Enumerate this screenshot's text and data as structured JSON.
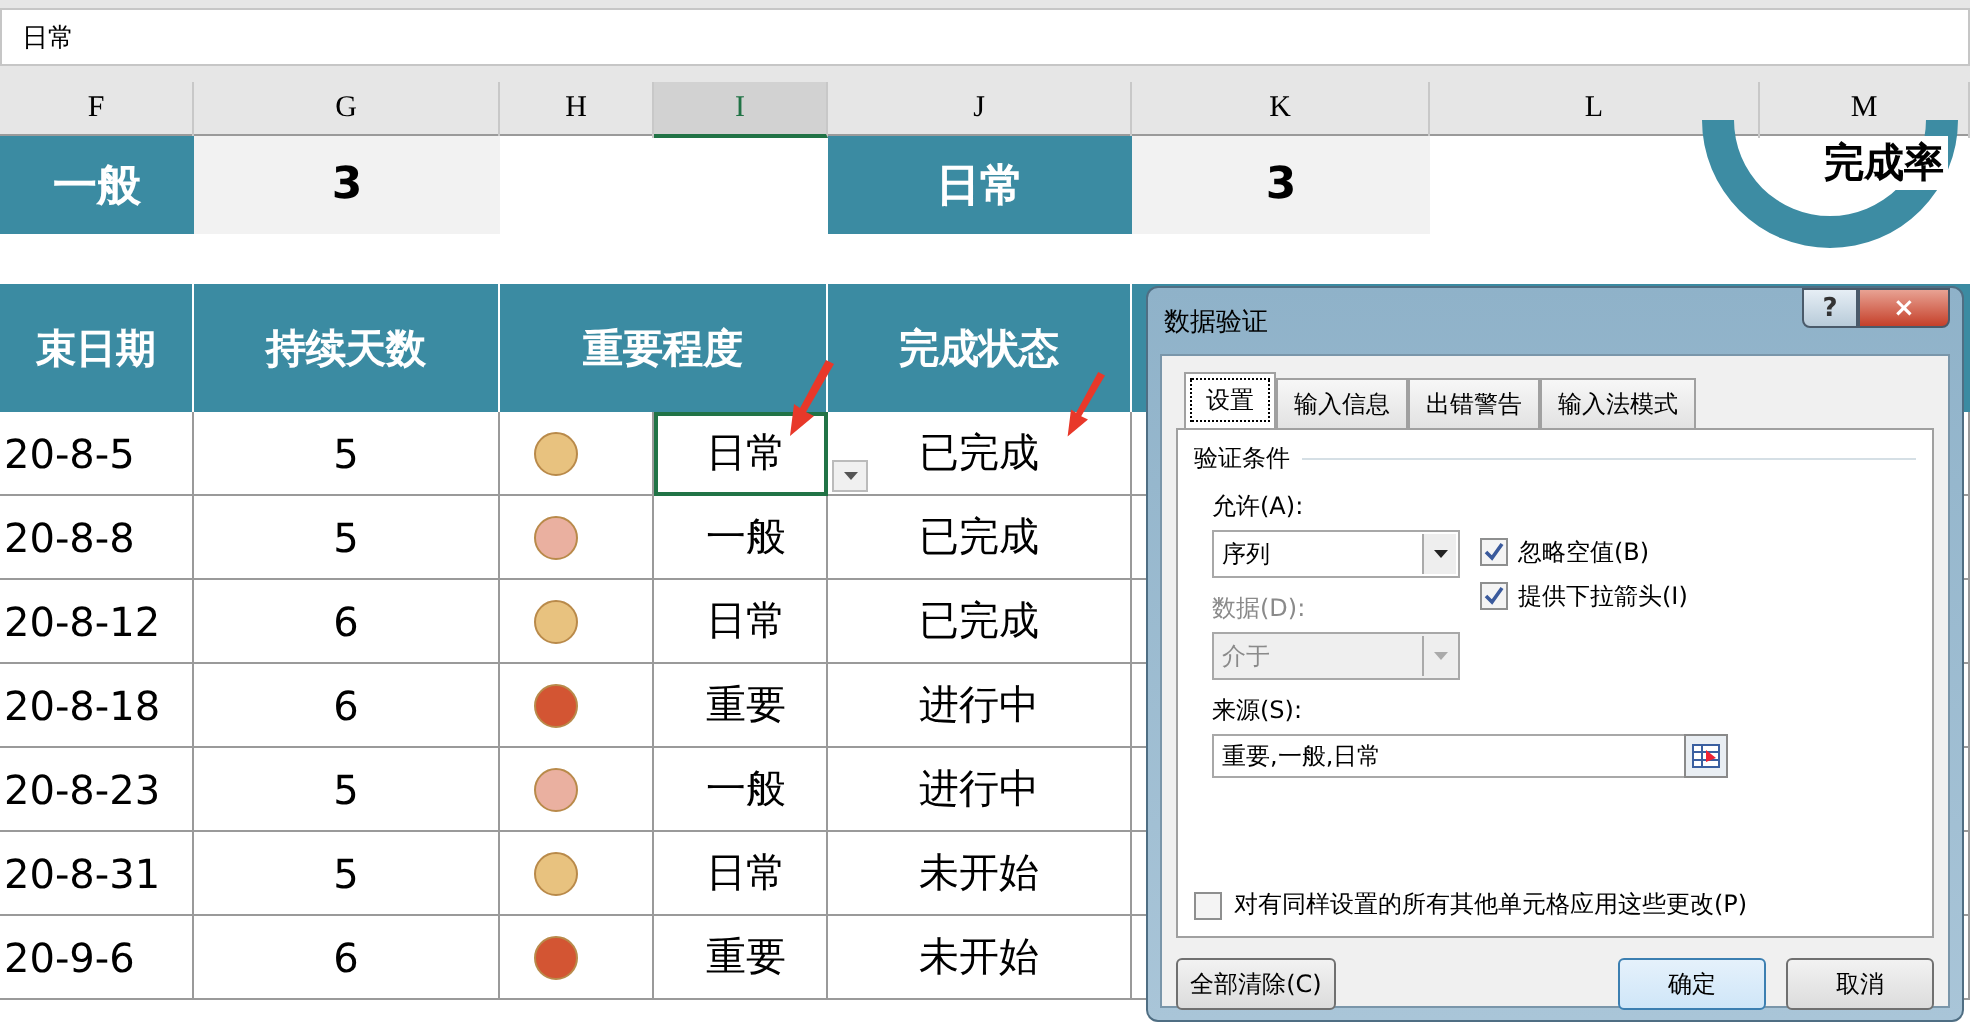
{
  "formula_bar": {
    "value": "日常"
  },
  "column_headers": [
    {
      "label": "F",
      "selected": false
    },
    {
      "label": "G",
      "selected": false
    },
    {
      "label": "H",
      "selected": false
    },
    {
      "label": "I",
      "selected": true
    },
    {
      "label": "J",
      "selected": false
    },
    {
      "label": "K",
      "selected": false
    },
    {
      "label": "L",
      "selected": false
    },
    {
      "label": "M",
      "selected": false
    }
  ],
  "summary": [
    {
      "kind": "label",
      "text": "一般"
    },
    {
      "kind": "value",
      "text": "3"
    },
    {
      "kind": "empty"
    },
    {
      "kind": "label",
      "text": "日常"
    },
    {
      "kind": "value",
      "text": "3"
    }
  ],
  "donut_chart": {
    "label": "完成率"
  },
  "table": {
    "columns": [
      "束日期",
      "持续天数",
      "重要程度",
      "完成状态"
    ],
    "rows": [
      {
        "end_date": "20-8-5",
        "days": "5",
        "color": "#e8c27f",
        "importance": "日常",
        "status": "已完成",
        "selected": true
      },
      {
        "end_date": "20-8-8",
        "days": "5",
        "color": "#eab0a0",
        "importance": "一般",
        "status": "已完成",
        "selected": false
      },
      {
        "end_date": "20-8-12",
        "days": "6",
        "color": "#e8c27f",
        "importance": "日常",
        "status": "已完成",
        "selected": false
      },
      {
        "end_date": "20-8-18",
        "days": "6",
        "color": "#d35533",
        "importance": "重要",
        "status": "进行中",
        "selected": false
      },
      {
        "end_date": "20-8-23",
        "days": "5",
        "color": "#eab0a0",
        "importance": "一般",
        "status": "进行中",
        "selected": false
      },
      {
        "end_date": "20-8-31",
        "days": "5",
        "color": "#e8c27f",
        "importance": "日常",
        "status": "未开始",
        "selected": false
      },
      {
        "end_date": "20-9-6",
        "days": "6",
        "color": "#d35533",
        "importance": "重要",
        "status": "未开始",
        "selected": false
      }
    ]
  },
  "dialog": {
    "title": "数据验证",
    "help": "?",
    "close": "×",
    "tabs": [
      {
        "label": "设置",
        "selected": true
      },
      {
        "label": "输入信息",
        "selected": false
      },
      {
        "label": "出错警告",
        "selected": false
      },
      {
        "label": "输入法模式",
        "selected": false
      }
    ],
    "section": "验证条件",
    "allow_label": "允许(A):",
    "allow_value": "序列",
    "options": [
      {
        "label": "忽略空值(B)",
        "checked": true
      },
      {
        "label": "提供下拉箭头(I)",
        "checked": true
      }
    ],
    "data_label": "数据(D):",
    "data_value": "介于",
    "data_disabled": true,
    "source_label": "来源(S):",
    "source_value": "重要,一般,日常",
    "apply_all": {
      "label": "对有同样设置的所有其他单元格应用这些更改(P)",
      "checked": false
    },
    "buttons": [
      {
        "label": "全部清除(C)",
        "kind": "left"
      },
      {
        "label": "确定",
        "kind": "default"
      },
      {
        "label": "取消",
        "kind": "normal"
      }
    ]
  }
}
